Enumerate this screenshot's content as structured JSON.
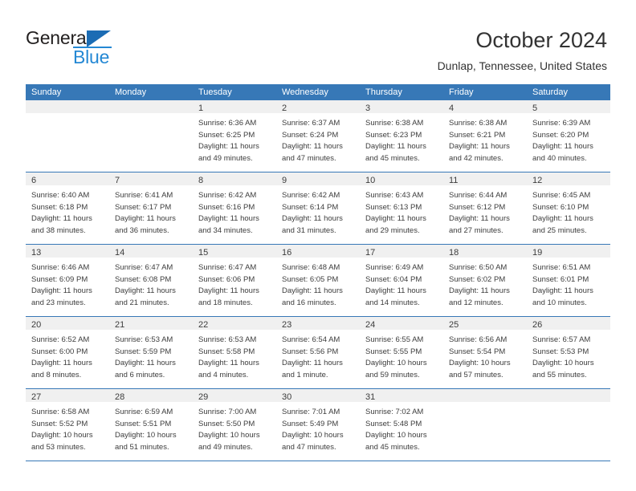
{
  "brand": {
    "name_dark": "General",
    "name_blue": "Blue",
    "triangle_icon": "triangle-icon",
    "accent_color": "#2488d4",
    "header_color": "#3778b7"
  },
  "header": {
    "title": "October 2024",
    "subtitle": "Dunlap, Tennessee, United States"
  },
  "calendar": {
    "weekdays": [
      "Sunday",
      "Monday",
      "Tuesday",
      "Wednesday",
      "Thursday",
      "Friday",
      "Saturday"
    ],
    "weeks": [
      [
        {
          "day": "",
          "lines": []
        },
        {
          "day": "",
          "lines": []
        },
        {
          "day": "1",
          "lines": [
            "Sunrise: 6:36 AM",
            "Sunset: 6:25 PM",
            "Daylight: 11 hours",
            "and 49 minutes."
          ]
        },
        {
          "day": "2",
          "lines": [
            "Sunrise: 6:37 AM",
            "Sunset: 6:24 PM",
            "Daylight: 11 hours",
            "and 47 minutes."
          ]
        },
        {
          "day": "3",
          "lines": [
            "Sunrise: 6:38 AM",
            "Sunset: 6:23 PM",
            "Daylight: 11 hours",
            "and 45 minutes."
          ]
        },
        {
          "day": "4",
          "lines": [
            "Sunrise: 6:38 AM",
            "Sunset: 6:21 PM",
            "Daylight: 11 hours",
            "and 42 minutes."
          ]
        },
        {
          "day": "5",
          "lines": [
            "Sunrise: 6:39 AM",
            "Sunset: 6:20 PM",
            "Daylight: 11 hours",
            "and 40 minutes."
          ]
        }
      ],
      [
        {
          "day": "6",
          "lines": [
            "Sunrise: 6:40 AM",
            "Sunset: 6:18 PM",
            "Daylight: 11 hours",
            "and 38 minutes."
          ]
        },
        {
          "day": "7",
          "lines": [
            "Sunrise: 6:41 AM",
            "Sunset: 6:17 PM",
            "Daylight: 11 hours",
            "and 36 minutes."
          ]
        },
        {
          "day": "8",
          "lines": [
            "Sunrise: 6:42 AM",
            "Sunset: 6:16 PM",
            "Daylight: 11 hours",
            "and 34 minutes."
          ]
        },
        {
          "day": "9",
          "lines": [
            "Sunrise: 6:42 AM",
            "Sunset: 6:14 PM",
            "Daylight: 11 hours",
            "and 31 minutes."
          ]
        },
        {
          "day": "10",
          "lines": [
            "Sunrise: 6:43 AM",
            "Sunset: 6:13 PM",
            "Daylight: 11 hours",
            "and 29 minutes."
          ]
        },
        {
          "day": "11",
          "lines": [
            "Sunrise: 6:44 AM",
            "Sunset: 6:12 PM",
            "Daylight: 11 hours",
            "and 27 minutes."
          ]
        },
        {
          "day": "12",
          "lines": [
            "Sunrise: 6:45 AM",
            "Sunset: 6:10 PM",
            "Daylight: 11 hours",
            "and 25 minutes."
          ]
        }
      ],
      [
        {
          "day": "13",
          "lines": [
            "Sunrise: 6:46 AM",
            "Sunset: 6:09 PM",
            "Daylight: 11 hours",
            "and 23 minutes."
          ]
        },
        {
          "day": "14",
          "lines": [
            "Sunrise: 6:47 AM",
            "Sunset: 6:08 PM",
            "Daylight: 11 hours",
            "and 21 minutes."
          ]
        },
        {
          "day": "15",
          "lines": [
            "Sunrise: 6:47 AM",
            "Sunset: 6:06 PM",
            "Daylight: 11 hours",
            "and 18 minutes."
          ]
        },
        {
          "day": "16",
          "lines": [
            "Sunrise: 6:48 AM",
            "Sunset: 6:05 PM",
            "Daylight: 11 hours",
            "and 16 minutes."
          ]
        },
        {
          "day": "17",
          "lines": [
            "Sunrise: 6:49 AM",
            "Sunset: 6:04 PM",
            "Daylight: 11 hours",
            "and 14 minutes."
          ]
        },
        {
          "day": "18",
          "lines": [
            "Sunrise: 6:50 AM",
            "Sunset: 6:02 PM",
            "Daylight: 11 hours",
            "and 12 minutes."
          ]
        },
        {
          "day": "19",
          "lines": [
            "Sunrise: 6:51 AM",
            "Sunset: 6:01 PM",
            "Daylight: 11 hours",
            "and 10 minutes."
          ]
        }
      ],
      [
        {
          "day": "20",
          "lines": [
            "Sunrise: 6:52 AM",
            "Sunset: 6:00 PM",
            "Daylight: 11 hours",
            "and 8 minutes."
          ]
        },
        {
          "day": "21",
          "lines": [
            "Sunrise: 6:53 AM",
            "Sunset: 5:59 PM",
            "Daylight: 11 hours",
            "and 6 minutes."
          ]
        },
        {
          "day": "22",
          "lines": [
            "Sunrise: 6:53 AM",
            "Sunset: 5:58 PM",
            "Daylight: 11 hours",
            "and 4 minutes."
          ]
        },
        {
          "day": "23",
          "lines": [
            "Sunrise: 6:54 AM",
            "Sunset: 5:56 PM",
            "Daylight: 11 hours",
            "and 1 minute."
          ]
        },
        {
          "day": "24",
          "lines": [
            "Sunrise: 6:55 AM",
            "Sunset: 5:55 PM",
            "Daylight: 10 hours",
            "and 59 minutes."
          ]
        },
        {
          "day": "25",
          "lines": [
            "Sunrise: 6:56 AM",
            "Sunset: 5:54 PM",
            "Daylight: 10 hours",
            "and 57 minutes."
          ]
        },
        {
          "day": "26",
          "lines": [
            "Sunrise: 6:57 AM",
            "Sunset: 5:53 PM",
            "Daylight: 10 hours",
            "and 55 minutes."
          ]
        }
      ],
      [
        {
          "day": "27",
          "lines": [
            "Sunrise: 6:58 AM",
            "Sunset: 5:52 PM",
            "Daylight: 10 hours",
            "and 53 minutes."
          ]
        },
        {
          "day": "28",
          "lines": [
            "Sunrise: 6:59 AM",
            "Sunset: 5:51 PM",
            "Daylight: 10 hours",
            "and 51 minutes."
          ]
        },
        {
          "day": "29",
          "lines": [
            "Sunrise: 7:00 AM",
            "Sunset: 5:50 PM",
            "Daylight: 10 hours",
            "and 49 minutes."
          ]
        },
        {
          "day": "30",
          "lines": [
            "Sunrise: 7:01 AM",
            "Sunset: 5:49 PM",
            "Daylight: 10 hours",
            "and 47 minutes."
          ]
        },
        {
          "day": "31",
          "lines": [
            "Sunrise: 7:02 AM",
            "Sunset: 5:48 PM",
            "Daylight: 10 hours",
            "and 45 minutes."
          ]
        },
        {
          "day": "",
          "lines": []
        },
        {
          "day": "",
          "lines": []
        }
      ]
    ]
  }
}
